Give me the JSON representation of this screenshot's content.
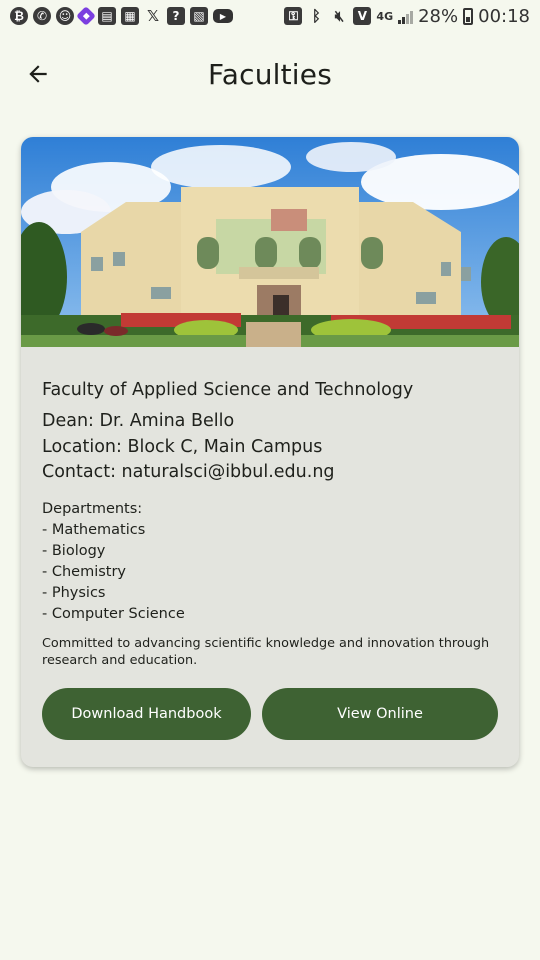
{
  "status_bar": {
    "battery_percent": "28%",
    "time": "00:18",
    "network": "4G"
  },
  "header": {
    "title": "Faculties",
    "back_icon": "arrow-left-icon"
  },
  "faculty": {
    "name": "Faculty of Applied Science and Technology",
    "dean": "Dean: Dr. Amina Bello",
    "location": "Location: Block C, Main Campus",
    "contact": "Contact: naturalsci@ibbul.edu.ng",
    "departments_heading": "Departments:",
    "departments": [
      "- Mathematics",
      "- Biology",
      "- Chemistry",
      "- Physics",
      "- Computer Science"
    ],
    "description": "Committed to advancing scientific knowledge and innovation through research and education."
  },
  "actions": {
    "download_label": "Download Handbook",
    "view_label": "View Online"
  },
  "colors": {
    "background": "#f5f8ee",
    "card": "#e3e4de",
    "button": "#3e6233"
  }
}
